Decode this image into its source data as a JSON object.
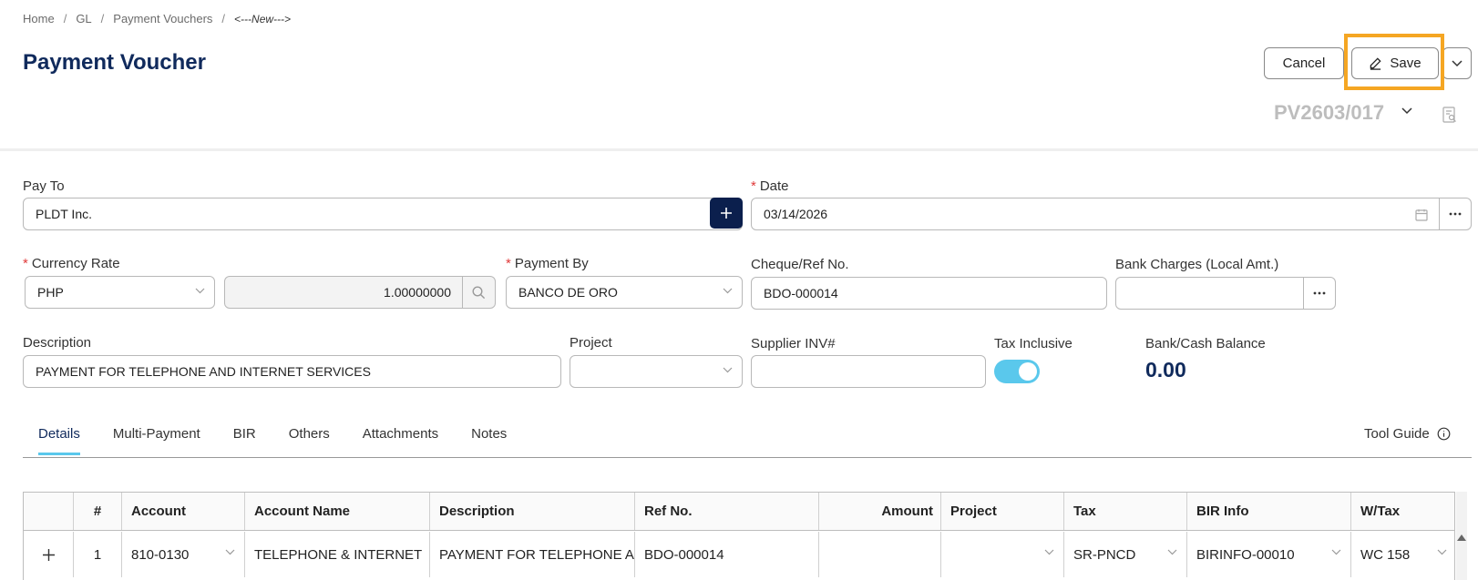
{
  "breadcrumb": {
    "home": "Home",
    "gl": "GL",
    "payment_vouchers": "Payment Vouchers",
    "current": "<---New--->"
  },
  "page_title": "Payment Voucher",
  "actions": {
    "cancel": "Cancel",
    "save": "Save"
  },
  "doc_number": "PV2603/017",
  "form": {
    "pay_to": {
      "label": "Pay To",
      "value": "PLDT Inc."
    },
    "date": {
      "label": "Date",
      "value": "03/14/2026"
    },
    "currency_rate": {
      "label": "Currency Rate",
      "currency": "PHP",
      "rate": "1.00000000"
    },
    "payment_by": {
      "label": "Payment By",
      "value": "BANCO DE ORO"
    },
    "cheque_ref": {
      "label": "Cheque/Ref No.",
      "value": "BDO-000014"
    },
    "bank_charges": {
      "label": "Bank Charges (Local Amt.)",
      "value": ""
    },
    "description": {
      "label": "Description",
      "value": "PAYMENT FOR TELEPHONE AND INTERNET SERVICES"
    },
    "project": {
      "label": "Project",
      "value": ""
    },
    "supplier_inv": {
      "label": "Supplier INV#",
      "value": ""
    },
    "tax_inclusive": {
      "label": "Tax Inclusive",
      "on": true
    },
    "bank_cash_balance": {
      "label": "Bank/Cash Balance",
      "value": "0.00"
    }
  },
  "tabs": [
    "Details",
    "Multi-Payment",
    "BIR",
    "Others",
    "Attachments",
    "Notes"
  ],
  "active_tab": "Details",
  "tool_guide": "Tool Guide",
  "table": {
    "columns": [
      "#",
      "Account",
      "Account Name",
      "Description",
      "Ref No.",
      "Amount",
      "Project",
      "Tax",
      "BIR Info",
      "W/Tax"
    ],
    "rows": [
      {
        "num": "1",
        "account": "810-0130",
        "account_name": "TELEPHONE & INTERNET",
        "description": "PAYMENT FOR TELEPHONE ANI",
        "ref_no": "BDO-000014",
        "amount": "",
        "project": "",
        "tax": "SR-PNCD",
        "bir_info": "BIRINFO-00010",
        "wtax": "WC 158"
      }
    ]
  },
  "colors": {
    "brand": "#102a5c",
    "accent": "#5ac8ec",
    "highlight": "#f5a623",
    "required": "#e03a3a"
  }
}
